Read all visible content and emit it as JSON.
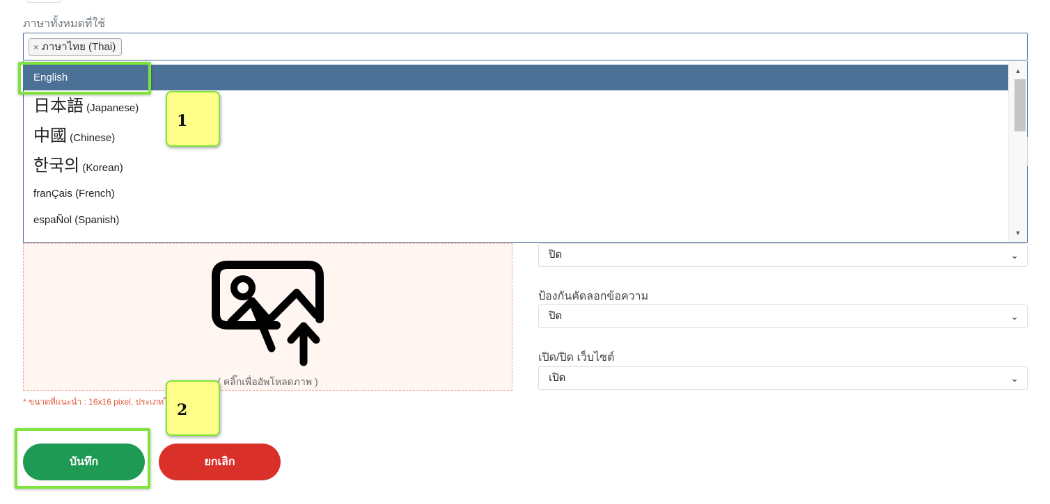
{
  "language_field": {
    "label": "ภาษาทั้งหมดที่ใช้",
    "selected_chip": {
      "remove_symbol": "×",
      "label": "ภาษาไทย (Thai)"
    }
  },
  "language_options": [
    {
      "native": "English",
      "english": "",
      "highlighted": true
    },
    {
      "native": "日本語",
      "english": " (Japanese)"
    },
    {
      "native": "中國",
      "english": " (Chinese)"
    },
    {
      "native": "한국의",
      "english": " (Korean)"
    },
    {
      "native": "",
      "english": "franÇais (French)"
    },
    {
      "native": "",
      "english": "espaÑol (Spanish)"
    }
  ],
  "scrollbar": {
    "up_arrow": "▲",
    "down_arrow": "▼"
  },
  "settings": {
    "select_1": {
      "value": "ปิด"
    },
    "copy_protect": {
      "label": "ป้องกันคัดลอกข้อความ",
      "value": "ปิด"
    },
    "site_toggle": {
      "label": "เปิด/ปิด เว็บไซต์",
      "value": "เปิด"
    },
    "chevron": "⌄"
  },
  "upload": {
    "icon": "image-upload-icon",
    "hint": "( คลิ๊กเพื่ออัพโหลดภาพ )",
    "note": "* ขนาดที่แนะนำ : 16x16 pixel, ประเภทไฟล์ .ico"
  },
  "buttons": {
    "save": "บันทึก",
    "cancel": "ยกเลิก"
  },
  "callouts": {
    "step1": "1",
    "step2": "2"
  },
  "colors": {
    "highlight_option": "#4b7196",
    "save_button": "#1f9a55",
    "cancel_button": "#d9302a",
    "callout_fill": "#ffff8a",
    "callout_border": "#7ee33a"
  }
}
